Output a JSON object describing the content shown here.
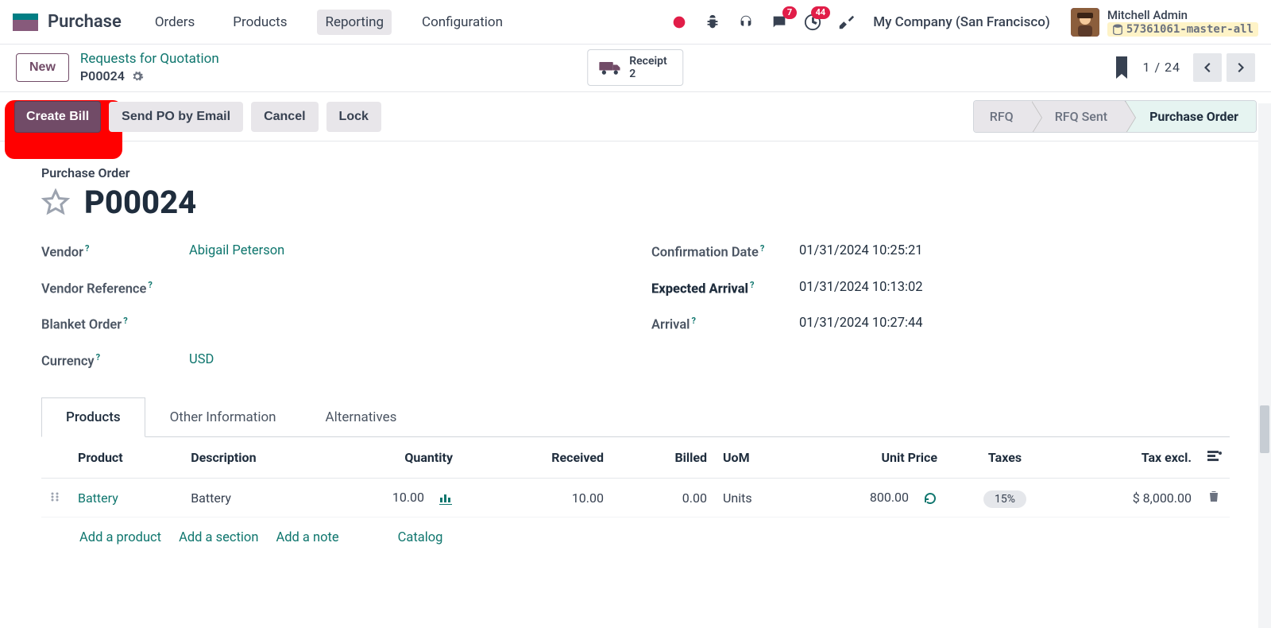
{
  "colors": {
    "accent": "#714b67",
    "teal": "#0f766e"
  },
  "topnav": {
    "app_name": "Purchase",
    "menu": [
      "Orders",
      "Products",
      "Reporting",
      "Configuration"
    ],
    "active_menu_index": 2,
    "company": "My Company (San Francisco)",
    "badges": {
      "messages": "7",
      "activities": "44"
    },
    "user_name": "Mitchell Admin",
    "db_name": "57361061-master-all"
  },
  "subhead": {
    "new_button": "New",
    "breadcrumb_top": "Requests for Quotation",
    "breadcrumb_bottom": "P00024",
    "receipt": {
      "label": "Receipt",
      "count": "2"
    },
    "pager": {
      "current": "1",
      "total": "24"
    }
  },
  "actions": {
    "create_bill": "Create Bill",
    "send_po": "Send PO by Email",
    "cancel": "Cancel",
    "lock": "Lock"
  },
  "status": {
    "steps": [
      "RFQ",
      "RFQ Sent",
      "Purchase Order"
    ],
    "active_index": 2
  },
  "sheet": {
    "type_label": "Purchase Order",
    "title": "P00024",
    "fields_left": [
      {
        "label": "Vendor",
        "value": "Abigail Peterson",
        "link": true,
        "help": true
      },
      {
        "label": "Vendor Reference",
        "value": "",
        "help": true
      },
      {
        "label": "Blanket Order",
        "value": "",
        "help": true
      },
      {
        "label": "Currency",
        "value": "USD",
        "link": true,
        "help": true
      }
    ],
    "fields_right": [
      {
        "label": "Confirmation Date",
        "value": "01/31/2024 10:25:21",
        "help": true
      },
      {
        "label": "Expected Arrival",
        "value": "01/31/2024 10:13:02",
        "help": true,
        "bold": true
      },
      {
        "label": "Arrival",
        "value": "01/31/2024 10:27:44",
        "help": true
      }
    ]
  },
  "tabs": {
    "items": [
      "Products",
      "Other Information",
      "Alternatives"
    ],
    "active_index": 0
  },
  "table": {
    "headers": [
      "Product",
      "Description",
      "Quantity",
      "Received",
      "Billed",
      "UoM",
      "Unit Price",
      "Taxes",
      "Tax excl."
    ],
    "rows": [
      {
        "product": "Battery",
        "description": "Battery",
        "quantity": "10.00",
        "received": "10.00",
        "billed": "0.00",
        "uom": "Units",
        "unit_price": "800.00",
        "tax": "15%",
        "tax_excl": "$ 8,000.00"
      }
    ],
    "add": {
      "product": "Add a product",
      "section": "Add a section",
      "note": "Add a note",
      "catalog": "Catalog"
    }
  }
}
